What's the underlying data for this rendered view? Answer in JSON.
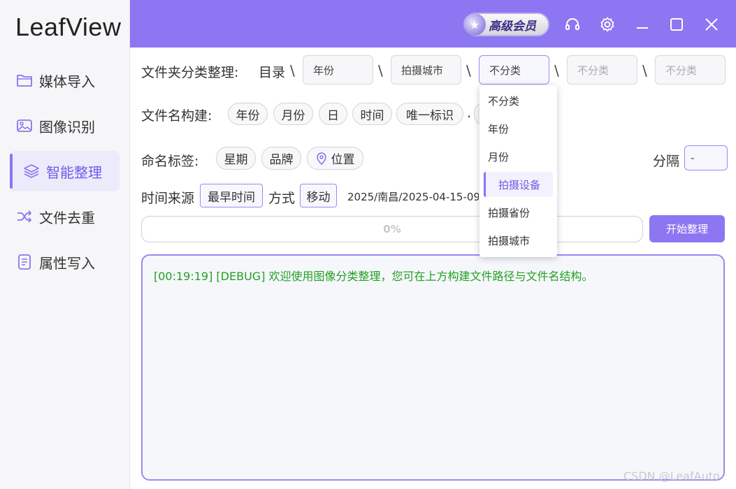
{
  "app": {
    "name": "LeafView"
  },
  "sidebar": {
    "items": [
      {
        "label": "媒体导入",
        "icon": "folder-icon"
      },
      {
        "label": "图像识别",
        "icon": "image-icon"
      },
      {
        "label": "智能整理",
        "icon": "layers-icon",
        "active": true
      },
      {
        "label": "文件去重",
        "icon": "shuffle-icon"
      },
      {
        "label": "属性写入",
        "icon": "document-icon"
      }
    ]
  },
  "header": {
    "vip_label": "高级会员",
    "icons": [
      "headset-icon",
      "gear-icon",
      "minimize-icon",
      "maximize-icon",
      "close-icon"
    ]
  },
  "folder_row": {
    "label": "文件夹分类整理:",
    "root": "目录",
    "separator": "\\",
    "levels": [
      "年份",
      "拍摄城市",
      "不分类",
      "不分类",
      "不分类"
    ]
  },
  "dropdown": {
    "options": [
      "不分类",
      "年份",
      "月份",
      "拍摄设备",
      "拍摄省份",
      "拍摄城市"
    ],
    "highlighted": "拍摄设备"
  },
  "filename_row": {
    "label": "文件名构建:",
    "chips": [
      "年份",
      "月份",
      "日",
      "时间",
      "唯一标识"
    ],
    "dot": "."
  },
  "tag_row": {
    "label": "命名标签:",
    "chips": [
      "星期",
      "品牌",
      "位置"
    ],
    "separator_label": "分隔",
    "separator_value": "-"
  },
  "time_row": {
    "source_label": "时间来源",
    "source_value": "最早时间",
    "method_label": "方式",
    "method_value": "移动",
    "preview": "2025/南昌/2025-04-15-09"
  },
  "progress": {
    "text": "0%",
    "value": 0
  },
  "start_button": "开始整理",
  "log": {
    "lines": [
      "[00:19:19] [DEBUG] 欢迎使用图像分类整理，您可在上方构建文件路径与文件名结构。"
    ]
  },
  "watermark": "CSDN @LeafAuto",
  "colors": {
    "accent": "#8d76f2",
    "log_text": "#23a023"
  }
}
